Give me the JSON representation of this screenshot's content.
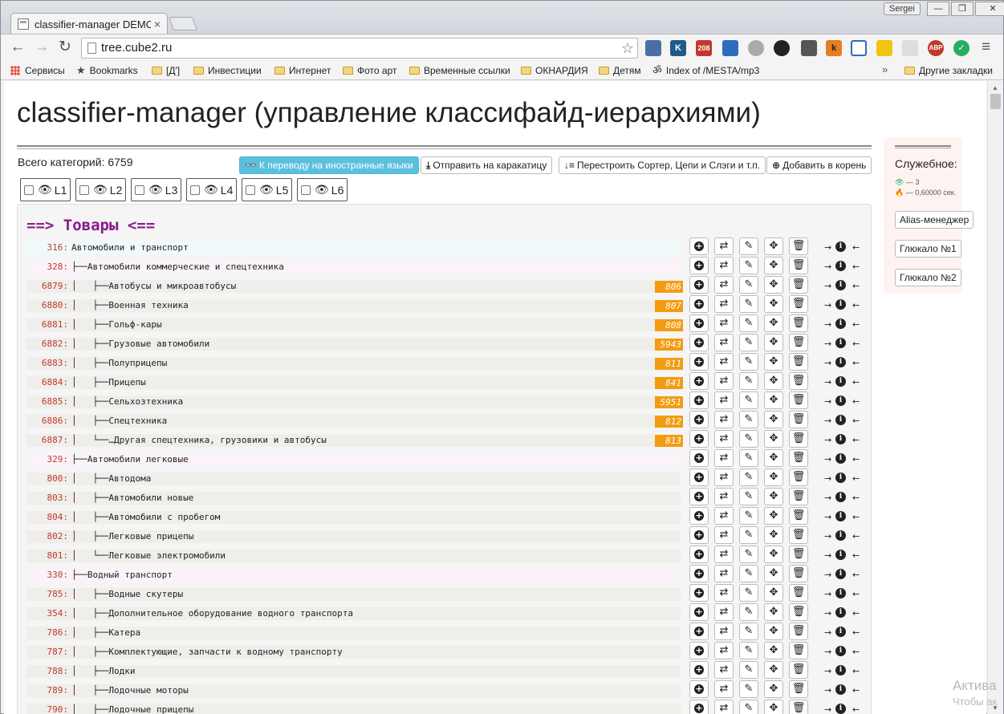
{
  "browser": {
    "tab_title": "classifier-manager DEMO",
    "tab_close": "×",
    "user": "Sergei",
    "url": "tree.cube2.ru",
    "window_buttons": [
      "—",
      "❐",
      "✕"
    ],
    "bookmarks": [
      "Сервисы",
      "Bookmarks",
      "[Д']",
      "Инвестиции",
      "Интернет",
      "Фото арт",
      "Временные ссылки",
      "ОКНАРДИЯ",
      "Детям",
      "Index of /MESTA/mp3"
    ],
    "bookmarks_more": "»",
    "other_bookmarks": "Другие закладки",
    "extensions": [
      "K",
      "208",
      "ABP"
    ]
  },
  "page": {
    "title": "classifier-manager (управление классифайд-иерархиями)",
    "count_label": "Всего категорий: 6759",
    "buttons": {
      "translate": "К переводу на иностранные языки",
      "send": "Отправить на каракатицу",
      "rebuild": "Перестроить Сортер, Цепи и Слэги и т.п.",
      "add_root": "Добавить в корень"
    },
    "levels": [
      "L1",
      "L2",
      "L3",
      "L4",
      "L5",
      "L6"
    ],
    "section_title": "==> Товары <=="
  },
  "side": {
    "label": "Служебное:",
    "stat_views": "— 3",
    "stat_time": "— 0,60000 сек.",
    "buttons": [
      "Alias-менеджер",
      "Глюкало №1",
      "Глюкало №2"
    ]
  },
  "row_actions": {
    "plus": "+",
    "swap": "⇄",
    "edit": "✎",
    "move": "✥",
    "trash": "🗑",
    "info": "i",
    "arrow_right": "→",
    "arrow_left": "←"
  },
  "colors": {
    "id_red": "#c0392b",
    "section_purple": "#8a1a8a",
    "badge_orange": "#f39c12",
    "primary_button": "#5bc0de"
  },
  "tree": [
    {
      "id": "316:",
      "text": "Автомобили и транспорт",
      "level": 0,
      "badge": ""
    },
    {
      "id": "328:",
      "text": "├──Автомобили коммерческие и спецтехника",
      "level": 1,
      "badge": ""
    },
    {
      "id": "6879:",
      "text": "│   ├──Автобусы и микроавтобусы",
      "level": 2,
      "badge": "806"
    },
    {
      "id": "6880:",
      "text": "│   ├──Военная техника",
      "level": 2,
      "badge": "807"
    },
    {
      "id": "6881:",
      "text": "│   ├──Гольф-кары",
      "level": 2,
      "badge": "808"
    },
    {
      "id": "6882:",
      "text": "│   ├──Грузовые автомобили",
      "level": 2,
      "badge": "5943"
    },
    {
      "id": "6883:",
      "text": "│   ├──Полуприцепы",
      "level": 2,
      "badge": "811"
    },
    {
      "id": "6884:",
      "text": "│   ├──Прицепы",
      "level": 2,
      "badge": "841"
    },
    {
      "id": "6885:",
      "text": "│   ├──Сельхозтехника",
      "level": 2,
      "badge": "5951"
    },
    {
      "id": "6886:",
      "text": "│   ├──Спецтехника",
      "level": 2,
      "badge": "812"
    },
    {
      "id": "6887:",
      "text": "│   └──…Другая спецтехника, грузовики и автобусы",
      "level": 2,
      "badge": "813"
    },
    {
      "id": "329:",
      "text": "├──Автомобили легковые",
      "level": 1,
      "badge": ""
    },
    {
      "id": "800:",
      "text": "│   ├──Автодома",
      "level": 2,
      "badge": ""
    },
    {
      "id": "803:",
      "text": "│   ├──Автомобили новые",
      "level": 2,
      "badge": ""
    },
    {
      "id": "804:",
      "text": "│   ├──Автомобили с пробегом",
      "level": 2,
      "badge": ""
    },
    {
      "id": "802:",
      "text": "│   ├──Легковые прицепы",
      "level": 2,
      "badge": ""
    },
    {
      "id": "801:",
      "text": "│   └──Легковые электромобили",
      "level": 2,
      "badge": ""
    },
    {
      "id": "330:",
      "text": "├──Водный транспорт",
      "level": 1,
      "badge": ""
    },
    {
      "id": "785:",
      "text": "│   ├──Водные скутеры",
      "level": 2,
      "badge": ""
    },
    {
      "id": "354:",
      "text": "│   ├──Дополнительное оборудование водного транспорта",
      "level": 2,
      "badge": ""
    },
    {
      "id": "786:",
      "text": "│   ├──Катера",
      "level": 2,
      "badge": ""
    },
    {
      "id": "787:",
      "text": "│   ├──Комплектующие, запчасти к водному транспорту",
      "level": 2,
      "badge": ""
    },
    {
      "id": "788:",
      "text": "│   ├──Лодки",
      "level": 2,
      "badge": ""
    },
    {
      "id": "789:",
      "text": "│   ├──Лодочные моторы",
      "level": 2,
      "badge": ""
    },
    {
      "id": "790:",
      "text": "│   ├──Лодочные прицепы",
      "level": 2,
      "badge": ""
    }
  ],
  "watermark": {
    "line1": "Актива",
    "line2": "Чтобы ак"
  }
}
